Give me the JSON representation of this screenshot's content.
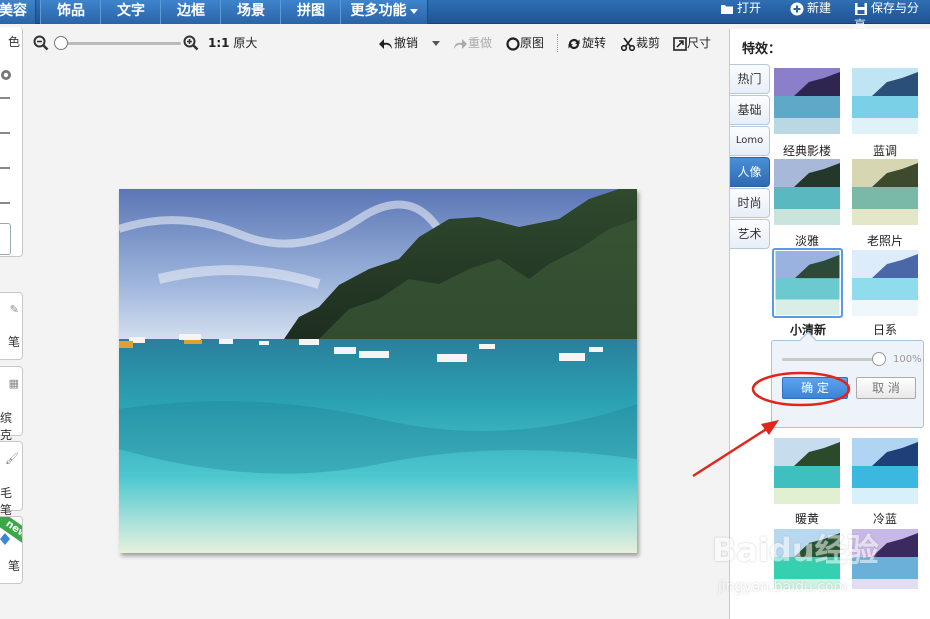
{
  "topnav": {
    "tabs": [
      "美容",
      "饰品",
      "文字",
      "边框",
      "场景",
      "拼图",
      "更多功能"
    ],
    "open_label": "打开",
    "new_label": "新建",
    "save_label": "保存与分享"
  },
  "left_strip": {
    "labels": [
      "色",
      "笔",
      "缤克",
      "毛笔",
      "笔"
    ],
    "new_badge": "new"
  },
  "toolbar": {
    "ratio_label": "1:1",
    "original_size_label": "原大",
    "undo_label": "撤销",
    "redo_label": "重做",
    "original_label": "原图",
    "rotate_label": "旋转",
    "crop_label": "裁剪",
    "size_label": "尺寸"
  },
  "right_panel": {
    "title": "特效：",
    "tabs": [
      "热门",
      "基础",
      "Lomo",
      "人像",
      "时尚",
      "艺术"
    ],
    "active_tab": "人像",
    "effects": [
      "经典影楼",
      "蓝调",
      "淡雅",
      "老照片",
      "小清新",
      "日系",
      "暖黄",
      "冷蓝"
    ],
    "selected_effect": "小清新",
    "slider_value": "100%",
    "confirm_label": "确 定",
    "cancel_label": "取 消"
  },
  "watermark": {
    "brand": "Baidu经验",
    "url": "jingyan.baidu.com"
  },
  "colors": {
    "nav_blue": "#2a64a6",
    "accent_blue": "#3a84d8",
    "annotation_red": "#e0261c"
  }
}
